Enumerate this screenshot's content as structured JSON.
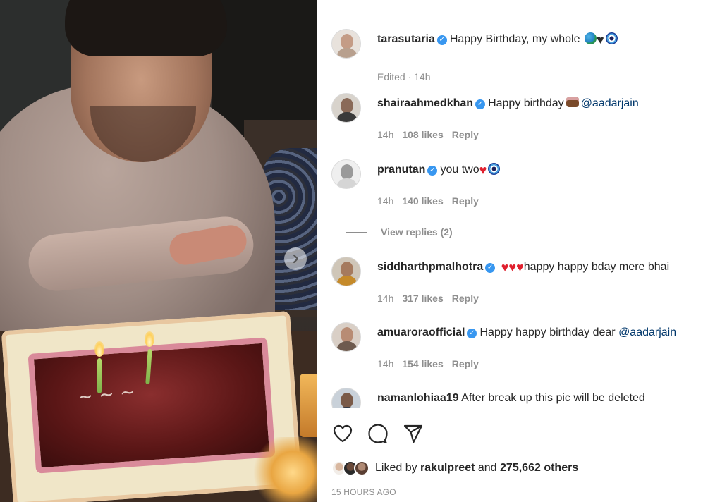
{
  "post": {
    "next_icon": "chevron-right-icon"
  },
  "comments": [
    {
      "username": "tarasutaria",
      "verified": true,
      "text": "Happy Birthday, my whole",
      "emojis": [
        "earth-globe",
        "black-heart",
        "nazar-amulet"
      ],
      "meta": "Edited · 14h"
    },
    {
      "username": "shairaahmedkhan",
      "verified": true,
      "text": "Happy birthday",
      "emoji": "birthday-cake",
      "mention": "@aadarjain",
      "time": "14h",
      "likes": "108 likes",
      "reply": "Reply"
    },
    {
      "username": "pranutan",
      "verified": true,
      "text": "you two",
      "emojis": [
        "red-heart",
        "nazar-amulet"
      ],
      "time": "14h",
      "likes": "140 likes",
      "reply": "Reply",
      "view_replies": "View replies (2)"
    },
    {
      "username": "siddharthpmalhotra",
      "verified": true,
      "emojis": [
        "red-heart",
        "red-heart",
        "red-heart"
      ],
      "text": "happy happy bday mere bhai",
      "time": "14h",
      "likes": "317 likes",
      "reply": "Reply"
    },
    {
      "username": "amuaroraofficial",
      "verified": true,
      "text": "Happy happy birthday dear",
      "mention": "@aadarjain",
      "time": "14h",
      "likes": "154 likes",
      "reply": "Reply"
    },
    {
      "username": "namanlohiaa19",
      "verified": false,
      "text": "After break up this pic will be deleted"
    }
  ],
  "actions": {
    "like_icon": "heart-outline-icon",
    "comment_icon": "comment-bubble-icon",
    "share_icon": "paper-plane-icon"
  },
  "likes": {
    "prefix": "Liked by",
    "user": "rakulpreet",
    "and": "and",
    "others": "275,662 others"
  },
  "timestamp": "15 HOURS AGO",
  "colors": {
    "verified_blue": "#3897f0",
    "mention_blue": "#00376b",
    "meta_gray": "#8e8e8e",
    "heart_red": "#e0202e"
  }
}
